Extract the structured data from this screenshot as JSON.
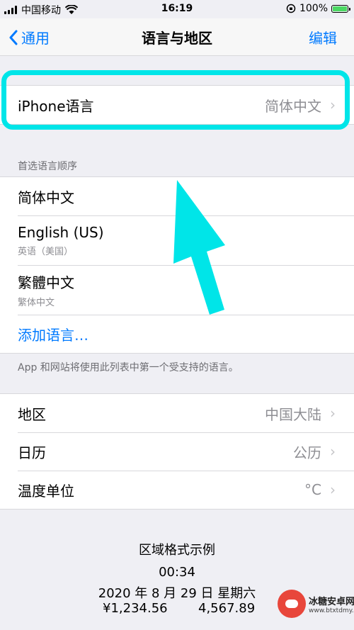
{
  "status": {
    "carrier": "中国移动",
    "time": "16:19",
    "battery": "100%",
    "battery_level": 1.0
  },
  "nav": {
    "back_label": "通用",
    "title": "语言与地区",
    "edit_label": "编辑"
  },
  "iphone_language": {
    "label": "iPhone语言",
    "value": "简体中文"
  },
  "preferred": {
    "header": "首选语言顺序",
    "items": [
      {
        "label": "简体中文",
        "sub": ""
      },
      {
        "label": "English (US)",
        "sub": "英语（美国）"
      },
      {
        "label": "繁體中文",
        "sub": "繁体中文"
      }
    ],
    "add_label": "添加语言…",
    "footnote": "App 和网站将使用此列表中第一个受支持的语言。"
  },
  "region_group": [
    {
      "label": "地区",
      "value": "中国大陆"
    },
    {
      "label": "日历",
      "value": "公历"
    },
    {
      "label": "温度单位",
      "value": "°C"
    }
  ],
  "format_example": {
    "title": "区域格式示例",
    "time": "00:34",
    "date": "2020 年 8 月 29 日 星期六",
    "money1": "¥1,234.56",
    "money2": "4,567.89"
  },
  "watermark": {
    "name": "冰糖安卓网",
    "url": "www.btxtdmy.com"
  },
  "colors": {
    "accent": "#007aff",
    "highlight": "#00e5e8",
    "background": "#efeff4"
  }
}
